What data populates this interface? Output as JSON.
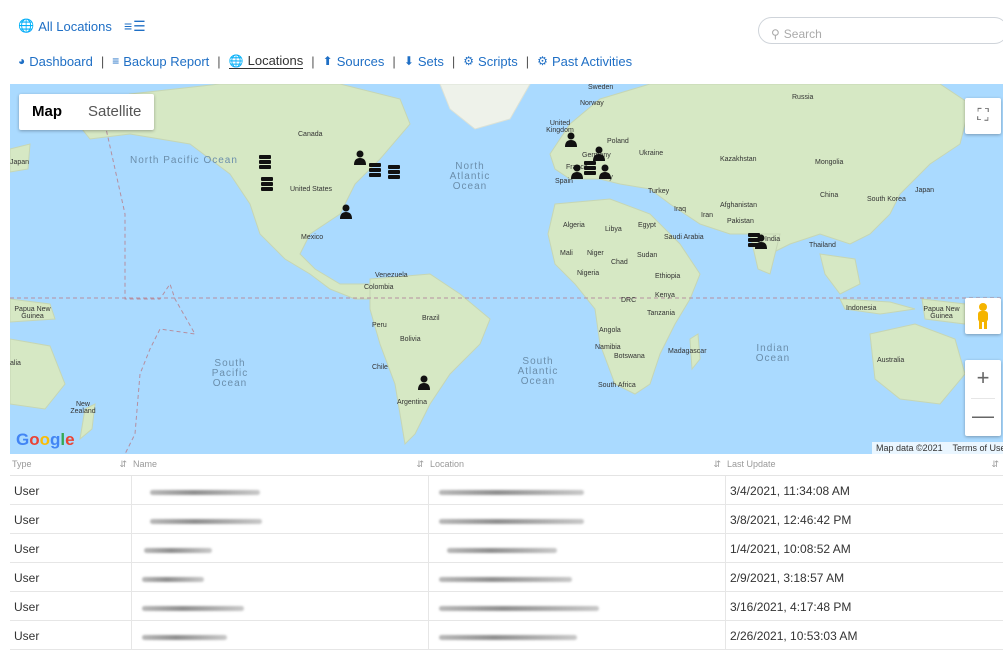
{
  "header": {
    "all_locations": "All Locations",
    "search_placeholder": "Search"
  },
  "nav": [
    {
      "label": "Dashboard",
      "icon": "dashboard-icon"
    },
    {
      "label": "Backup Report",
      "icon": "list-icon"
    },
    {
      "label": "Locations",
      "icon": "globe-icon"
    },
    {
      "label": "Sources",
      "icon": "upload-icon"
    },
    {
      "label": "Sets",
      "icon": "download-icon"
    },
    {
      "label": "Scripts",
      "icon": "gear-icon"
    },
    {
      "label": "Past Activities",
      "icon": "gears-icon"
    }
  ],
  "map": {
    "type_map": "Map",
    "type_satellite": "Satellite",
    "logo": "Google",
    "attribution_data": "Map data ©2021",
    "attribution_terms": "Terms of Use",
    "oceans": {
      "north_pacific": "North Pacific Ocean",
      "north_atlantic": "North Atlantic Ocean",
      "south_pacific": "South Pacific Ocean",
      "south_atlantic": "South Atlantic Ocean",
      "indian": "Indian Ocean"
    },
    "countries": {
      "russia": "Russia",
      "sweden": "Sweden",
      "norway": "Norway",
      "uk": "United Kingdom",
      "poland": "Poland",
      "germany": "Germany",
      "france": "France",
      "ukraine": "Ukraine",
      "spain": "Spain",
      "italy": "Italy",
      "kazakhstan": "Kazakhstan",
      "mongolia": "Mongolia",
      "china": "China",
      "japan_e": "Japan",
      "japan_w": "Japan",
      "south_korea": "South Korea",
      "turkey": "Turkey",
      "iraq": "Iraq",
      "iran": "Iran",
      "afghanistan": "Afghanistan",
      "pakistan": "Pakistan",
      "india": "India",
      "thailand": "Thailand",
      "canada": "Canada",
      "united_states": "United States",
      "mexico": "Mexico",
      "algeria": "Algeria",
      "libya": "Libya",
      "egypt": "Egypt",
      "saudi": "Saudi Arabia",
      "mali": "Mali",
      "niger": "Niger",
      "chad": "Chad",
      "sudan": "Sudan",
      "nigeria": "Nigeria",
      "ethiopia": "Ethiopia",
      "kenya": "Kenya",
      "drc": "DRC",
      "tanzania": "Tanzania",
      "angola": "Angola",
      "namibia": "Namibia",
      "botswana": "Botswana",
      "madagascar": "Madagascar",
      "south_africa": "South Africa",
      "venezuela": "Venezuela",
      "colombia": "Colombia",
      "peru": "Peru",
      "brazil": "Brazil",
      "bolivia": "Bolivia",
      "chile": "Chile",
      "argentina": "Argentina",
      "indonesia": "Indonesia",
      "png_w": "Papua New Guinea",
      "png_e": "Papua New Guinea",
      "australia": "Australia",
      "new_zealand": "New Zealand",
      "alia": "alia"
    }
  },
  "table": {
    "headers": [
      "Type",
      "Name",
      "Location",
      "Last Update"
    ],
    "rows": [
      {
        "type": "User",
        "last_update": "3/4/2021, 11:34:08 AM"
      },
      {
        "type": "User",
        "last_update": "3/8/2021, 12:46:42 PM"
      },
      {
        "type": "User",
        "last_update": "1/4/2021, 10:08:52 AM"
      },
      {
        "type": "User",
        "last_update": "2/9/2021, 3:18:57 AM"
      },
      {
        "type": "User",
        "last_update": "3/16/2021, 4:17:48 PM"
      },
      {
        "type": "User",
        "last_update": "2/26/2021, 10:53:03 AM"
      }
    ]
  },
  "colors": {
    "accent": "#1f6fc5",
    "water": "#aadaff",
    "land": "#d6e8c4"
  }
}
